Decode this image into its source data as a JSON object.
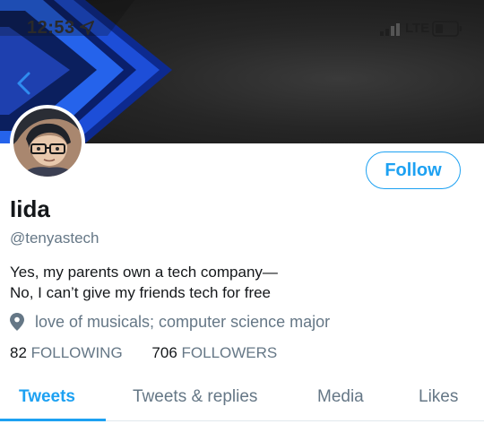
{
  "status_bar": {
    "time": "12:53",
    "carrier": "LTE",
    "location_icon": "location-arrow-icon",
    "signal_icon": "signal-bars-icon",
    "battery_icon": "battery-icon"
  },
  "nav": {
    "back_icon": "chevron-left-icon"
  },
  "profile": {
    "name": "Iida",
    "handle": "@tenyastech",
    "bio_lines": [
      "Yes, my parents own a tech company—",
      "No, I can’t give my friends tech for free"
    ],
    "location": "love of musicals; computer science major",
    "location_icon": "map-pin-icon",
    "following_count": "82",
    "following_label": "FOLLOWING",
    "followers_count": "706",
    "followers_label": "FOLLOWERS"
  },
  "actions": {
    "follow_label": "Follow"
  },
  "tabs": [
    {
      "label": "Tweets",
      "active": true
    },
    {
      "label": "Tweets & replies",
      "active": false
    },
    {
      "label": "Media",
      "active": false
    },
    {
      "label": "Likes",
      "active": false
    }
  ],
  "colors": {
    "accent": "#1da1f2",
    "text_primary": "#14171a",
    "text_secondary": "#657786",
    "banner_blue": "#1f4fd6"
  }
}
